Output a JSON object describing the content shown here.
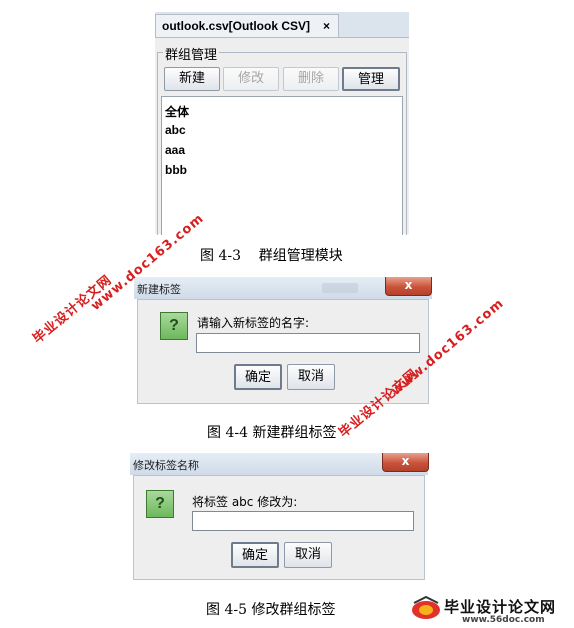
{
  "figure_4_3": {
    "tab_label": "outlook.csv[Outlook CSV]",
    "tab_close": "×",
    "group_title": "群组管理",
    "buttons": [
      {
        "label": "新建",
        "enabled": true
      },
      {
        "label": "修改",
        "enabled": false
      },
      {
        "label": "删除",
        "enabled": false
      },
      {
        "label": "管理",
        "enabled": true
      }
    ],
    "list_items": [
      "全体",
      "abc",
      "aaa",
      "bbb"
    ],
    "caption": "图 4-3    群组管理模块"
  },
  "figure_4_4": {
    "title": "新建标签",
    "close_label": "x",
    "prompt": "请输入新标签的名字:",
    "input_value": "",
    "ok_label": "确定",
    "cancel_label": "取消",
    "caption": "图 4-4 新建群组标签"
  },
  "figure_4_5": {
    "title": "修改标签名称",
    "close_label": "x",
    "prompt": "将标签 abc 修改为:",
    "input_value": "",
    "ok_label": "确定",
    "cancel_label": "取消",
    "caption": "图 4-5 修改群组标签"
  },
  "icons": {
    "question": "?",
    "dialog_icon": "question-icon"
  },
  "watermarks": {
    "site_name": "毕业设计论文网",
    "site_url": "www.doc163.com",
    "logo_text": "毕业设计论文网",
    "logo_url": "www.56doc.com",
    "color": "#d71f1f"
  }
}
